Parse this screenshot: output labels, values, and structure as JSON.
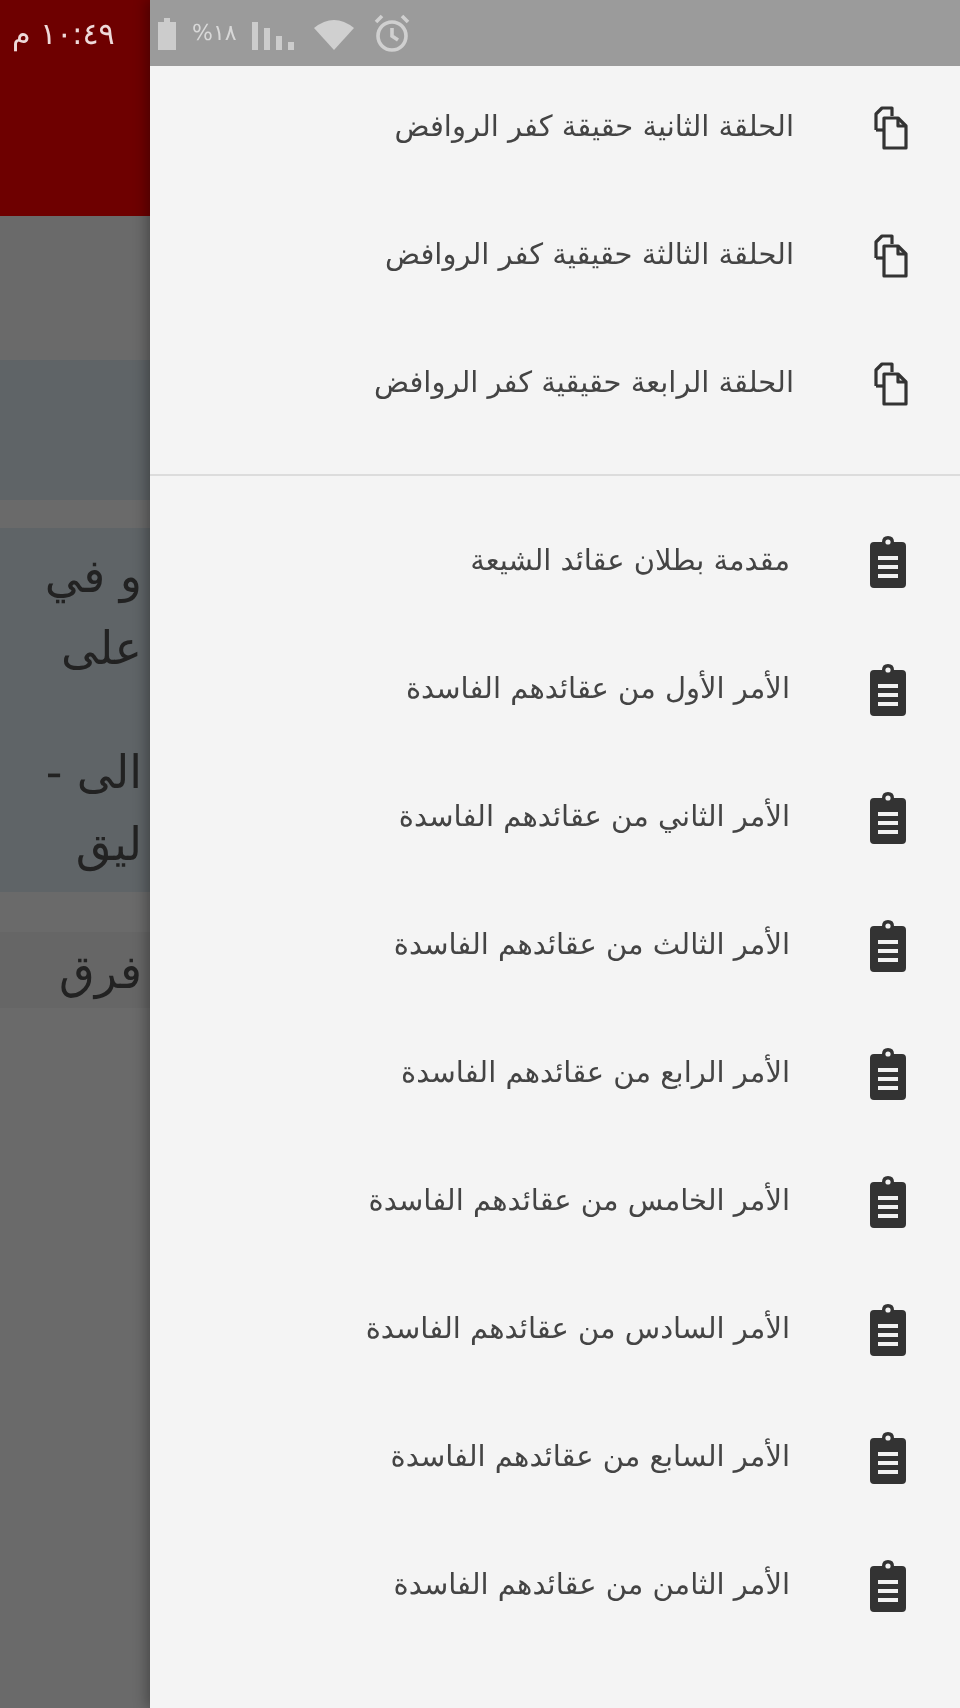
{
  "status_bar": {
    "time": "١٠:٤٩ م",
    "battery": "%١٨"
  },
  "background": {
    "blocks": [
      {
        "paragraphs": [
          [
            "و في",
            "على"
          ],
          [
            "الى -",
            "ليق"
          ]
        ]
      },
      {
        "paragraphs": [
          [
            "فرق"
          ]
        ]
      }
    ]
  },
  "drawer": {
    "sections": [
      {
        "kind": "episode",
        "items": [
          "الحلقة الثانية حقيقة كفر الروافض",
          "الحلقة الثالثة حقيقية كفر الروافض",
          "الحلقة الرابعة حقيقية كفر الروافض"
        ]
      },
      {
        "kind": "topic",
        "items": [
          "مقدمة بطلان عقائد الشيعة",
          "الأمر الأول من عقائدهم الفاسدة",
          "الأمر الثاني من عقائدهم الفاسدة",
          "الأمر الثالث من عقائدهم الفاسدة",
          "الأمر الرابع من عقائدهم الفاسدة",
          "الأمر الخامس من عقائدهم الفاسدة",
          "الأمر السادس من عقائدهم الفاسدة",
          "الأمر السابع من عقائدهم الفاسدة",
          "الأمر الثامن من عقائدهم الفاسدة"
        ]
      }
    ]
  }
}
